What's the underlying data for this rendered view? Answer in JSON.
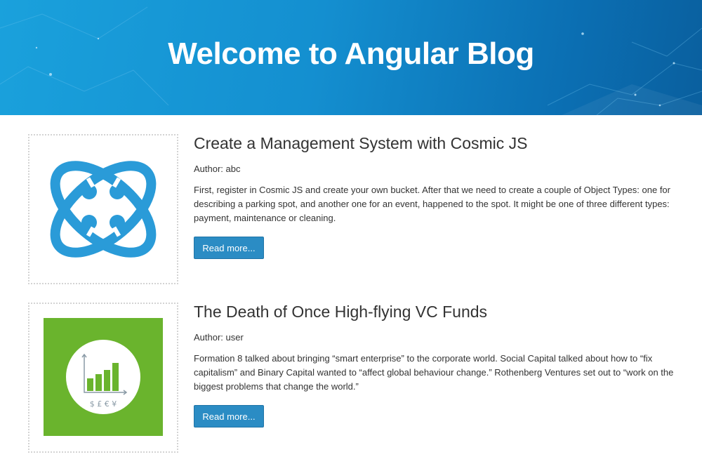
{
  "header": {
    "title": "Welcome to Angular Blog",
    "background_colors": [
      "#1aa1dc",
      "#0a5f9e"
    ]
  },
  "posts": [
    {
      "title": "Create a Management System with Cosmic JS",
      "author": "Author: abc",
      "excerpt": "First, register in Cosmic JS and create your own bucket. After that we need to create a couple of Object Types: one for describing a parking spot, and another one for an event, happened to the spot. It might be one of three different types: payment, maintenance or cleaning.",
      "button_label": "Read more...",
      "image_icon": "cosmic-js-logo",
      "image_color": "#2a9bd8"
    },
    {
      "title": "The Death of Once High-flying VC Funds",
      "author": "Author: user",
      "excerpt": "Formation 8 talked about bringing “smart enterprise” to the corporate world. Social Capital talked about how to “fix capitalism” and Binary Capital wanted to “affect global behaviour change.” Rothenberg Ventures set out to “work on the biggest problems that change the world.”",
      "button_label": "Read more...",
      "image_icon": "currency-bar-chart-icon",
      "image_color": "#6ab42d",
      "image_text": "$ £ € ¥"
    }
  ],
  "accent_color": "#2b8cc4"
}
